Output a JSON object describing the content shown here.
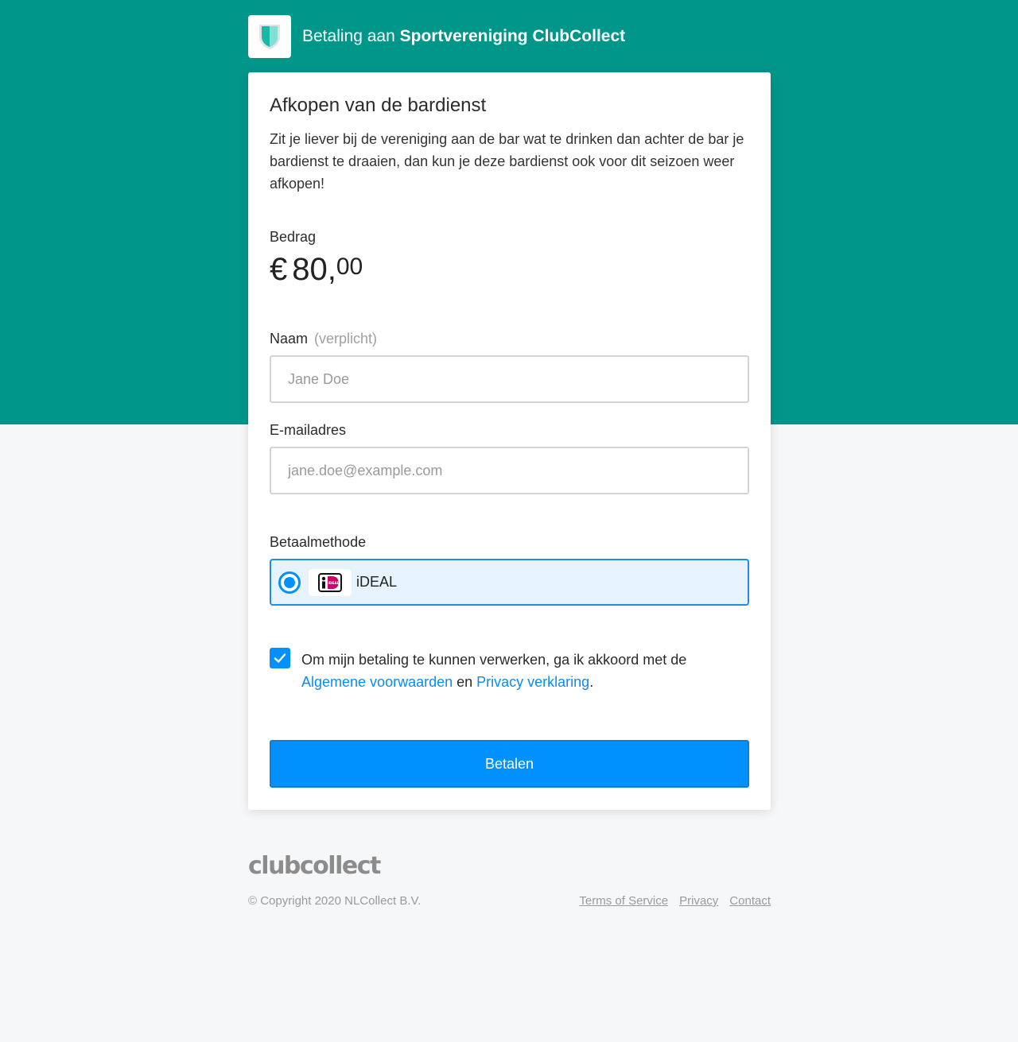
{
  "header": {
    "title_prefix": "Betaling aan ",
    "club_name": "Sportvereniging ClubCollect",
    "logo_icon": "shield-icon"
  },
  "card": {
    "title": "Afkopen van de bardienst",
    "description": "Zit je liever bij de vereniging aan de bar wat te drinken dan achter de bar je bardienst te draaien, dan kun je deze bardienst ook voor dit seizoen weer afkopen!",
    "amount_label": "Bedrag",
    "amount": {
      "currency": "€",
      "whole": "80,",
      "cents": "00"
    }
  },
  "form": {
    "name": {
      "label": "Naam",
      "required_hint": "(verplicht)",
      "placeholder": "Jane Doe",
      "value": ""
    },
    "email": {
      "label": "E-mailadres",
      "placeholder": "jane.doe@example.com",
      "value": ""
    },
    "payment_method": {
      "label": "Betaalmethode",
      "options": [
        {
          "label": "iDEAL",
          "selected": true,
          "icon": "ideal-icon"
        }
      ]
    },
    "consent": {
      "checked": true,
      "text_before": "Om mijn betaling te kunnen verwerken, ga ik akkoord met de ",
      "terms_link": "Algemene voorwaarden",
      "text_middle": " en ",
      "privacy_link": "Privacy verklaring",
      "text_after": "."
    },
    "submit_label": "Betalen"
  },
  "footer": {
    "logo_text": "clubcollect",
    "copyright": "© Copyright 2020 NLCollect B.V.",
    "links": [
      "Terms of Service",
      "Privacy",
      "Contact"
    ]
  },
  "colors": {
    "brand_teal": "#00968a",
    "primary_blue": "#0091ff",
    "link_blue": "#0a8cf0",
    "selected_bg": "#e6f3fd"
  }
}
